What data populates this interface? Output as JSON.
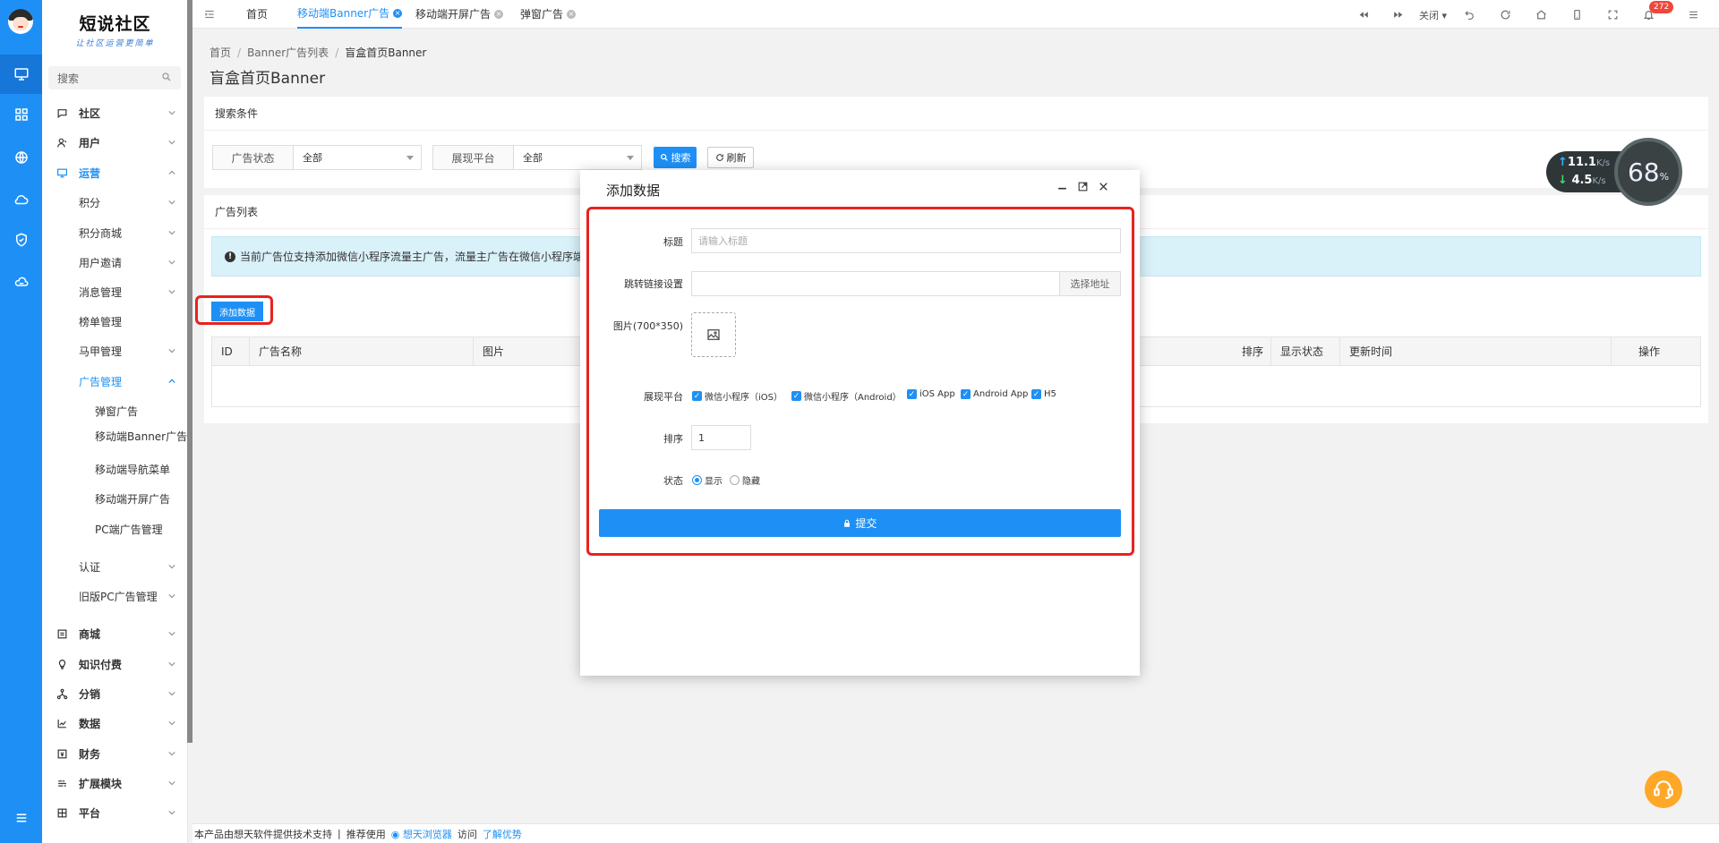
{
  "logo": {
    "name": "短说社区",
    "slogan": "让社区运营更简单"
  },
  "sidebar": {
    "search_placeholder": "搜索",
    "items": [
      {
        "label": "社区",
        "icon": "chat-icon"
      },
      {
        "label": "用户",
        "icon": "user-icon"
      },
      {
        "label": "运营",
        "icon": "monitor-icon"
      },
      {
        "label": "积分"
      },
      {
        "label": "积分商城"
      },
      {
        "label": "用户邀请"
      },
      {
        "label": "消息管理"
      },
      {
        "label": "榜单管理"
      },
      {
        "label": "马甲管理"
      },
      {
        "label": "广告管理"
      },
      {
        "label": "弹窗广告"
      },
      {
        "label": "移动端Banner广告"
      },
      {
        "label": "移动端导航菜单"
      },
      {
        "label": "移动端开屏广告"
      },
      {
        "label": "PC端广告管理"
      },
      {
        "label": "认证"
      },
      {
        "label": "旧版PC广告管理"
      },
      {
        "label": "商城",
        "icon": "shop-icon"
      },
      {
        "label": "知识付费",
        "icon": "bulb-icon"
      },
      {
        "label": "分销",
        "icon": "share-icon"
      },
      {
        "label": "数据",
        "icon": "chart-icon"
      },
      {
        "label": "财务",
        "icon": "finance-icon"
      },
      {
        "label": "扩展模块",
        "icon": "extension-icon"
      },
      {
        "label": "平台",
        "icon": "platform-icon"
      }
    ]
  },
  "tabs": [
    {
      "label": "首页"
    },
    {
      "label": "移动端Banner广告"
    },
    {
      "label": "移动端开屏广告"
    },
    {
      "label": "弹窗广告"
    }
  ],
  "toolbar": {
    "close_label": "关闭",
    "badge_count": "272"
  },
  "breadcrumb": [
    "首页",
    "Banner广告列表",
    "盲盒首页Banner"
  ],
  "page_title": "盲盒首页Banner",
  "search_panel": {
    "title": "搜索条件",
    "filters": [
      {
        "label": "广告状态",
        "value": "全部"
      },
      {
        "label": "展现平台",
        "value": "全部"
      }
    ],
    "search_btn": "搜索",
    "refresh_btn": "刷新"
  },
  "list_panel": {
    "title": "广告列表",
    "notice": "当前广告位支持添加微信小程序流量主广告，流量主广告在微信小程序端将",
    "add_btn": "添加数据",
    "columns": [
      "ID",
      "广告名称",
      "图片",
      "排序",
      "显示状态",
      "更新时间",
      "操作"
    ]
  },
  "speed_widget": {
    "up": "11.1",
    "down": "4.5",
    "unit": "K/s",
    "percent": "68",
    "percent_unit": "%"
  },
  "footer": {
    "text1": "本产品由想天软件提供技术支持",
    "sep": "|",
    "text2": "推荐使用",
    "browser": "想天浏览器",
    "text3": "访问",
    "link": "了解优势"
  },
  "modal": {
    "title": "添加数据",
    "fields": {
      "title_label": "标题",
      "title_placeholder": "请输入标题",
      "link_label": "跳转链接设置",
      "link_btn": "选择地址",
      "image_label": "图片(700*350)",
      "platform_label": "展现平台",
      "platforms": [
        "微信小程序（iOS）",
        "微信小程序（Android）",
        "iOS App",
        "Android App",
        "H5"
      ],
      "sort_label": "排序",
      "sort_value": "1",
      "status_label": "状态",
      "status_options": [
        "显示",
        "隐藏"
      ]
    },
    "submit": "提交"
  },
  "colors": {
    "primary": "#1e90f5",
    "highlight": "#e8221e",
    "badge": "#f0463b"
  }
}
